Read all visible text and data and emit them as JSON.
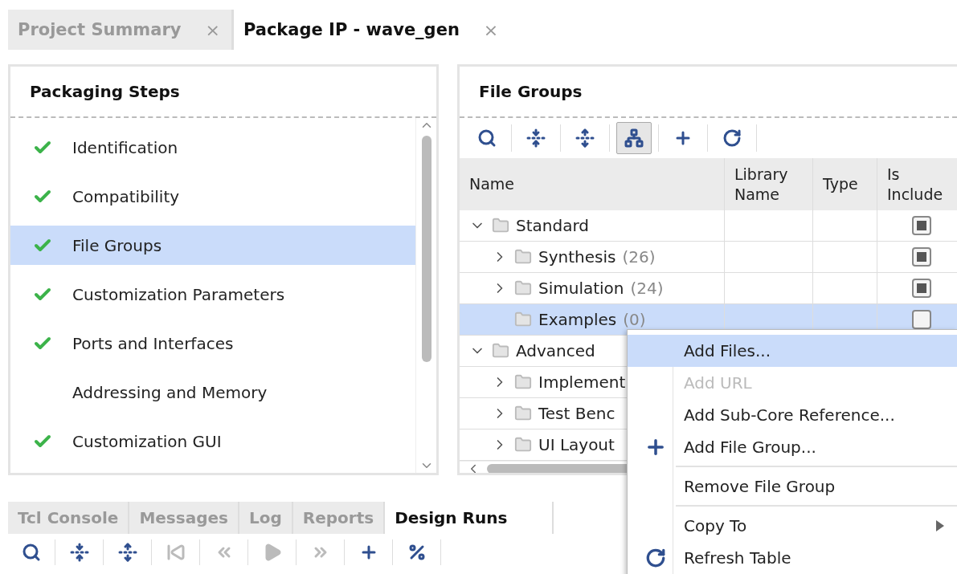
{
  "editor_tabs": [
    {
      "label": "Project Summary",
      "selected": false,
      "close": "×"
    },
    {
      "label": "Package IP - wave_gen",
      "selected": true,
      "close": "×"
    }
  ],
  "packaging_steps": {
    "title": "Packaging Steps",
    "items": [
      {
        "label": "Identification",
        "done": true,
        "selected": false
      },
      {
        "label": "Compatibility",
        "done": true,
        "selected": false
      },
      {
        "label": "File Groups",
        "done": true,
        "selected": true
      },
      {
        "label": "Customization Parameters",
        "done": true,
        "selected": false
      },
      {
        "label": "Ports and Interfaces",
        "done": true,
        "selected": false
      },
      {
        "label": "Addressing and Memory",
        "done": false,
        "selected": false
      },
      {
        "label": "Customization GUI",
        "done": true,
        "selected": false
      }
    ]
  },
  "file_groups": {
    "title": "File Groups",
    "toolbar": [
      {
        "pressed": false
      },
      {
        "pressed": false
      },
      {
        "pressed": false
      },
      {
        "pressed": true
      },
      {
        "pressed": false
      },
      {
        "pressed": false
      }
    ],
    "columns": [
      "Name",
      "Library Name",
      "Type",
      "Is Include"
    ],
    "rows": [
      {
        "name": "Standard",
        "expanded": true,
        "selected": false,
        "checked": true,
        "children": [
          {
            "name": "Synthesis",
            "count": "(26)",
            "expanded": false,
            "selected": false,
            "checked": true
          },
          {
            "name": "Simulation",
            "count": "(24)",
            "expanded": false,
            "selected": false,
            "checked": true
          },
          {
            "name": "Examples",
            "count": "(0)",
            "selected": true,
            "checked": false
          }
        ]
      },
      {
        "name": "Advanced",
        "expanded": true,
        "selected": false,
        "children": [
          {
            "name": "Implement",
            "expanded": false,
            "selected": false
          },
          {
            "name": "Test Benc",
            "expanded": false,
            "selected": false
          },
          {
            "name": "UI Layout",
            "expanded": false,
            "selected": false
          }
        ]
      }
    ]
  },
  "bottom_tabs": [
    {
      "label": "Tcl Console",
      "selected": false
    },
    {
      "label": "Messages",
      "selected": false
    },
    {
      "label": "Log",
      "selected": false
    },
    {
      "label": "Reports",
      "selected": false
    },
    {
      "label": "Design Runs",
      "selected": true
    }
  ],
  "bottom_toolbar": [
    {
      "disabled": false
    },
    {
      "disabled": false
    },
    {
      "disabled": false
    },
    {
      "disabled": true
    },
    {
      "disabled": true
    },
    {
      "disabled": true
    },
    {
      "disabled": true
    },
    {
      "disabled": false
    },
    {
      "disabled": false
    }
  ],
  "context_menu": [
    {
      "label": "Add Files...",
      "selected": true,
      "disabled": false
    },
    {
      "label": "Add URL",
      "selected": false,
      "disabled": true
    },
    {
      "label": "Add Sub-Core Reference...",
      "selected": false,
      "disabled": false
    },
    {
      "label": "Add File Group...",
      "selected": false,
      "disabled": false,
      "kind": "add"
    },
    {
      "label": "Remove File Group",
      "selected": false,
      "disabled": false,
      "separator_before": true
    },
    {
      "label": "Copy To",
      "selected": false,
      "disabled": false,
      "separator_before": true,
      "submenu": true
    },
    {
      "label": "Refresh Table",
      "selected": false,
      "disabled": false,
      "kind": "refresh"
    }
  ]
}
